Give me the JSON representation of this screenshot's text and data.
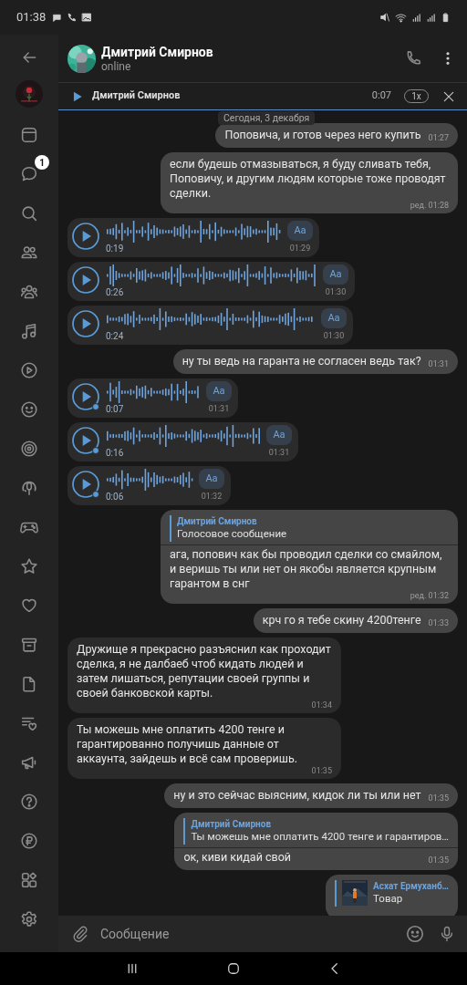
{
  "status_bar": {
    "time": "01:38"
  },
  "sidebar": {
    "unread_badge": "1"
  },
  "chat": {
    "title": "Дмитрий Смирнов",
    "status": "online"
  },
  "player": {
    "title": "Дмитрий Смирнов",
    "time": "0:07",
    "speed": "1x"
  },
  "date_label": "Сегодня, 3 декабря",
  "messages": [
    {
      "kind": "text",
      "outgoing": true,
      "text": "Поповича, и готов через него купить",
      "time": "01:27"
    },
    {
      "kind": "text",
      "outgoing": true,
      "text": "если будешь отмазываться, я буду сливать тебя, Поповичу, и другим людям которые тоже проводят сделки.",
      "time": "ред. 01:28"
    },
    {
      "kind": "voice",
      "outgoing": false,
      "duration": "0:19",
      "time": "01:29",
      "unplayed": false,
      "button": "Aa"
    },
    {
      "kind": "voice",
      "outgoing": false,
      "duration": "0:26",
      "time": "01:30",
      "unplayed": false,
      "button": "Aa"
    },
    {
      "kind": "voice",
      "outgoing": false,
      "duration": "0:24",
      "time": "01:30",
      "unplayed": false,
      "button": "Aa"
    },
    {
      "kind": "text",
      "outgoing": true,
      "text": "ну ты ведь на гаранта не согласен ведь так?",
      "time": "01:31"
    },
    {
      "kind": "voice",
      "outgoing": false,
      "duration": "0:07",
      "time": "01:31",
      "unplayed": true,
      "button": "Aa"
    },
    {
      "kind": "voice",
      "outgoing": false,
      "duration": "0:16",
      "time": "01:31",
      "unplayed": true,
      "button": "Aa"
    },
    {
      "kind": "voice",
      "outgoing": false,
      "duration": "0:06",
      "time": "01:32",
      "unplayed": true,
      "button": "Aa"
    },
    {
      "kind": "reply",
      "outgoing": true,
      "reply": {
        "name": "Дмитрий Смирнов",
        "text": "Голосовое сообщение"
      },
      "text": "ага, попович как бы проводил сделки со смайлом, и веришь ты или нет он якобы является крупным гарантом в снг",
      "time": "ред. 01:32"
    },
    {
      "kind": "text",
      "outgoing": true,
      "text": "крч го я тебе скину 4200тенге",
      "time": "01:33"
    },
    {
      "kind": "text",
      "outgoing": false,
      "text": "Дружище я прекрасно разъяснил как проходит сделка, я не далбаеб чтоб кидать людей и затем лишаться, репутации своей группы и своей банковской карты.",
      "time": "01:34"
    },
    {
      "kind": "text",
      "outgoing": false,
      "text": "Ты можешь мне оплатить 4200 тенге и гарантированно получишь данные от аккаунта, зайдешь и всё сам проверишь.",
      "time": "01:35"
    },
    {
      "kind": "text",
      "outgoing": true,
      "text": "ну и это сейчас выясним, кидок ли ты или нет",
      "time": "01:35"
    },
    {
      "kind": "reply",
      "outgoing": true,
      "reply": {
        "name": "Дмитрий Смирнов",
        "text": "Ты можешь мне оплатить 4200 тенге и гарантиров…"
      },
      "text": "ок, киви кидай свой",
      "time": "01:35"
    },
    {
      "kind": "reply",
      "outgoing": true,
      "reply": {
        "name": "Асхат Ермуханб…",
        "text": "Товар",
        "thumbnail": true
      }
    }
  ],
  "composer": {
    "placeholder": "Сообщение"
  }
}
